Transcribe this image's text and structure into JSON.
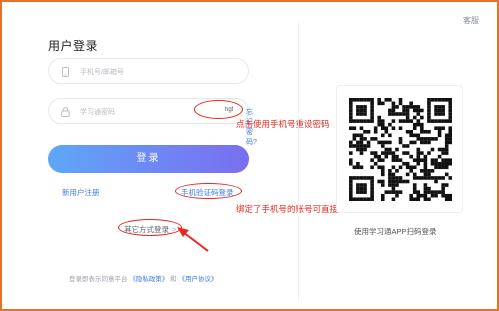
{
  "header": {
    "service_label": "客服"
  },
  "login": {
    "title": "用户登录",
    "phone_placeholder": "手机号/邮箱号",
    "password_placeholder": "学习通密码",
    "eye_label": "hgf",
    "forgot_label": "忘记密码?",
    "login_button": "登录",
    "register_label": "新用户注册",
    "sms_login_label": "手机验证码登录",
    "other_login_label": "其它方式登录",
    "other_login_chevron": ">"
  },
  "annotations": {
    "note_forgot": "点击使用手机号重设密码",
    "note_sms": "绑定了手机号的账号可直接用验证码登录",
    "annotation_color": "#e8271f"
  },
  "agreement": {
    "prefix": "登录即表示同意平台",
    "privacy_link": "《隐私政策》",
    "and": "和",
    "user_link": "《用户协议》"
  },
  "qr": {
    "caption": "使用学习通APP扫码登录"
  },
  "colors": {
    "accent": "#3c7be8",
    "button_gradient_start": "#5ea7f7",
    "button_gradient_end": "#7a6ff0",
    "frame_border": "#e8712a"
  }
}
